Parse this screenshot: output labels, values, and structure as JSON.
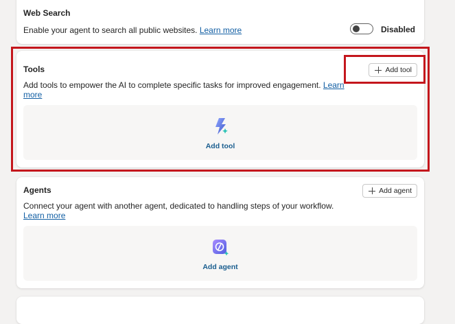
{
  "web_search": {
    "title": "Web Search",
    "description": "Enable your agent to search all public websites.",
    "learn_more": "Learn more",
    "toggle_state": "Disabled",
    "toggle_on": false
  },
  "tools": {
    "title": "Tools",
    "add_button": "Add tool",
    "description": "Add tools to empower the AI to complete specific tasks for improved engagement.",
    "learn_more": "Learn more",
    "dropzone_label": "Add tool",
    "icon": "lightning-tool-icon"
  },
  "agents": {
    "title": "Agents",
    "add_button": "Add agent",
    "description": "Connect your agent with another agent, dedicated to handling steps of your workflow.",
    "learn_more": "Learn more",
    "dropzone_label": "Add agent",
    "icon": "agent-icon"
  },
  "colors": {
    "highlight": "#c4161c",
    "link": "#115ea3",
    "tool_icon": "#5b6fd8",
    "agent_icon": "#7d5cd6"
  }
}
